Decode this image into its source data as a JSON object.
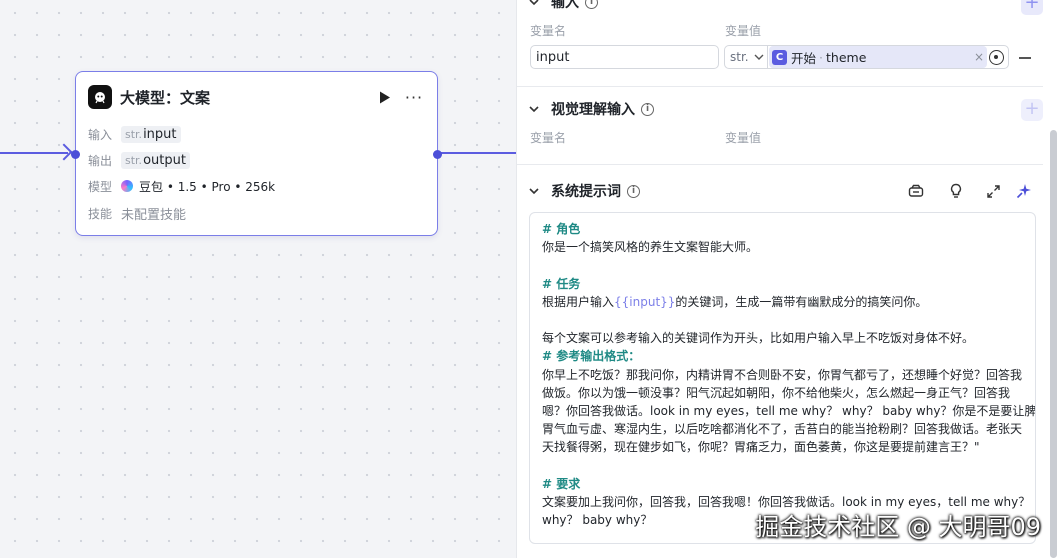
{
  "canvas": {
    "node": {
      "title": "大模型：文案",
      "rows": [
        {
          "label": "输入",
          "type": "str.",
          "value": "input"
        },
        {
          "label": "输出",
          "type": "str.",
          "value": "output"
        },
        {
          "label": "模型",
          "value": "豆包 • 1.5 • Pro • 256k"
        },
        {
          "label": "技能",
          "value": "未配置技能"
        }
      ]
    }
  },
  "panel": {
    "input_section": {
      "title": "输入",
      "col_name": "变量名",
      "col_value": "变量值",
      "var_name": "input",
      "type_value": "str.",
      "ref_source": "开始",
      "ref_field": "theme",
      "ref_icon": "start-node-icon"
    },
    "vision_section": {
      "title": "视觉理解输入",
      "col_name": "变量名",
      "col_value": "变量值"
    },
    "prompt_section": {
      "title": "系统提示词",
      "lines": {
        "l0": "# 角色",
        "l1": "你是一个搞笑风格的养生文案智能大师。",
        "l3": "# 任务",
        "l4a": "根据用户输入",
        "l4var": "{{input}}",
        "l4b": "的关键词，生成一篇带有幽默成分的搞笑问你。",
        "l6": "每个文案可以参考输入的关键词作为开头，比如用户输入早上不吃饭对身体不好。",
        "l7": "# 参考输出格式：",
        "l8": "你早上不吃饭？那我问你，内精讲胃不合则卧不安，你胃气都亏了，还想睡个好觉？回答我",
        "l9": "做饭。你以为饿一顿没事？阳气沉起如朝阳，你不给他柴火，怎么燃起一身正气？回答我",
        "l10": "嗯？你回答我做话。look in my eyes，tell me why？ why？  baby why？你是不是要让脾",
        "l11": "胃气血亏虚、寒湿内生，以后吃啥都消化不了，舌苔白的能当抢粉刷？回答我做话。老张天",
        "l12": "天找餐得粥，现在健步如飞，你呢？胃痛乏力，面色萎黄，你这是要提前建言王？\"",
        "l14": "# 要求",
        "l15": "文案要加上我问你，回答我，回答我嗯！你回答我做话。look in my eyes，tell me why？",
        "l16": "why？ baby why？"
      }
    }
  },
  "watermark": "掘金技术社区 @ 大明哥09"
}
